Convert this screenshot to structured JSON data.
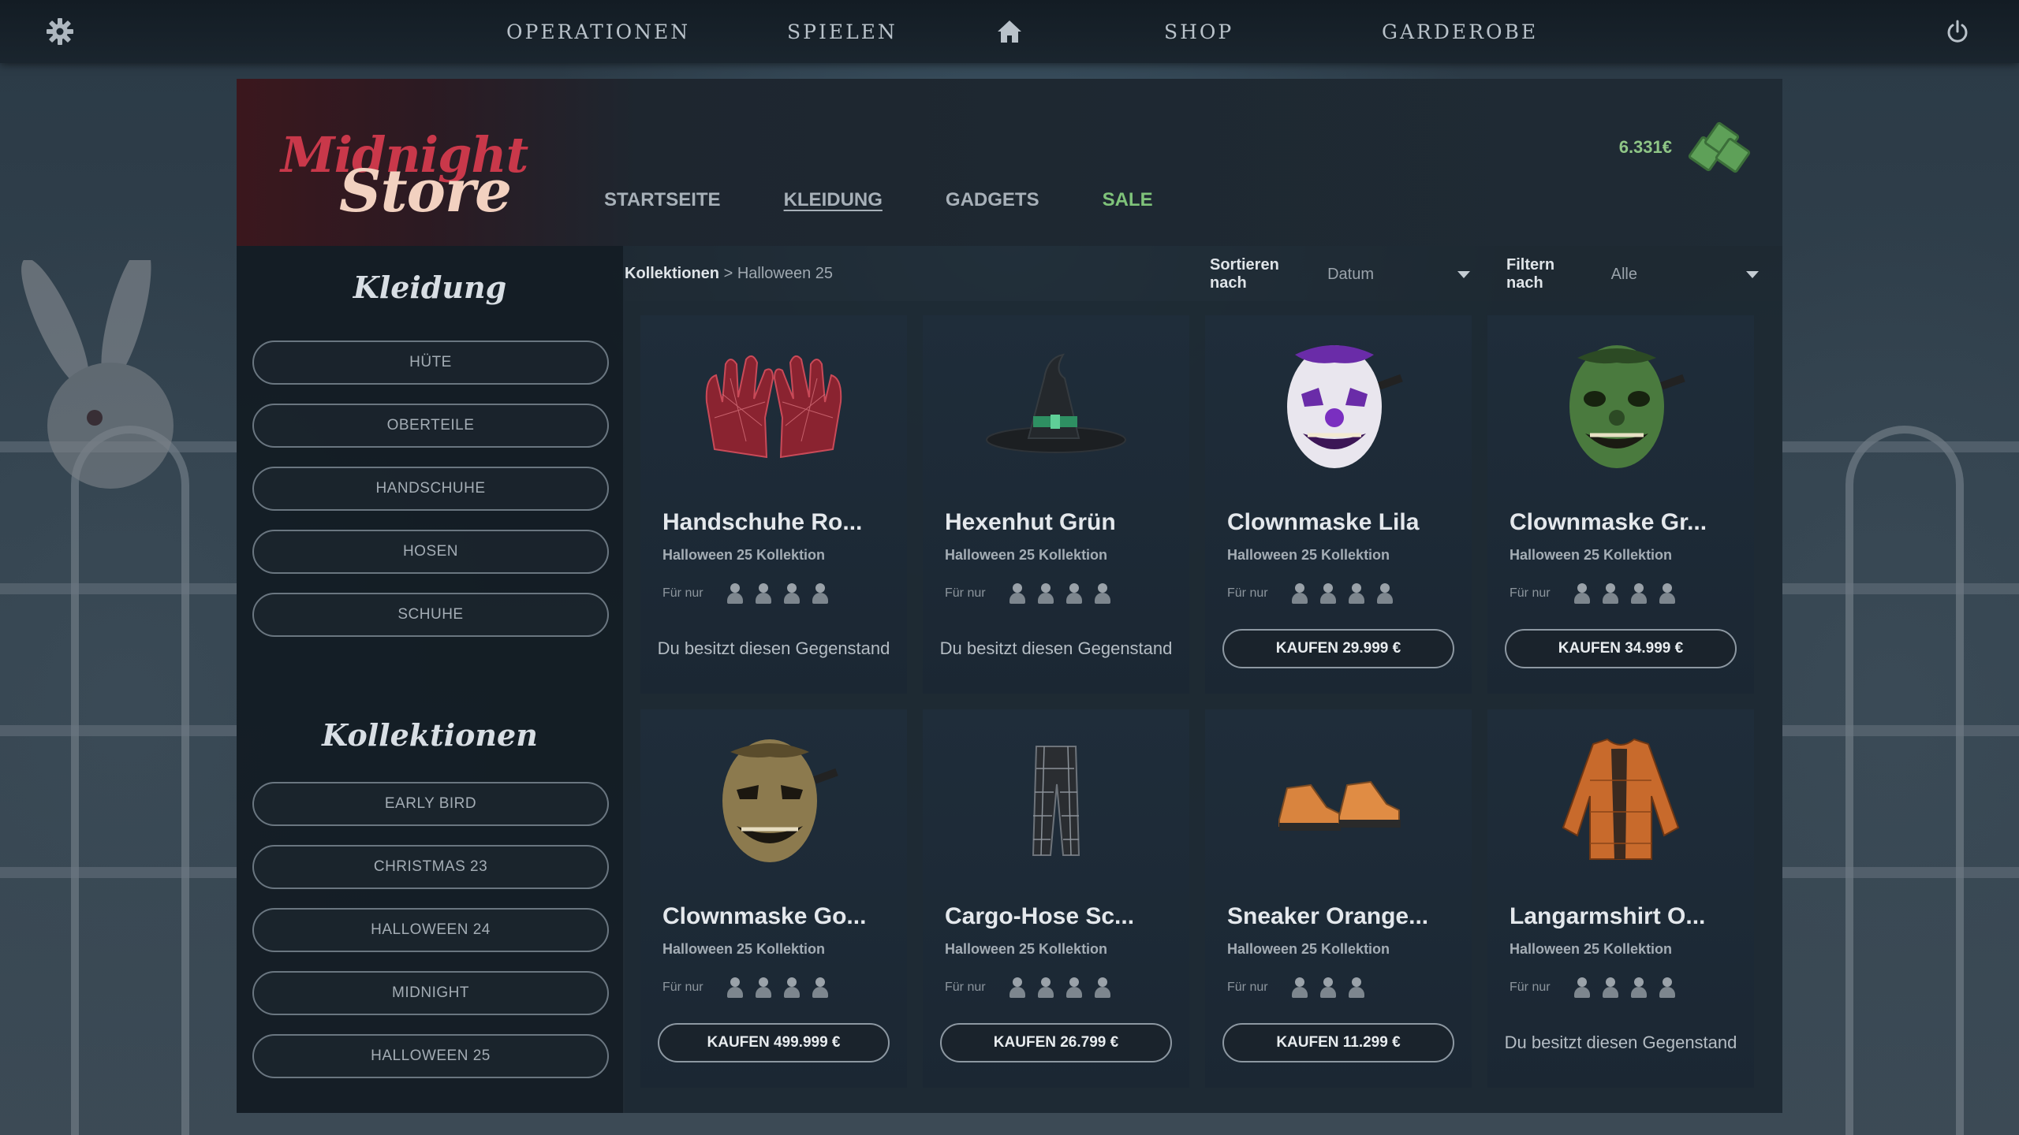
{
  "topnav": {
    "items": [
      "OPERATIONEN",
      "SPIELEN",
      "SHOP",
      "GARDEROBE"
    ]
  },
  "logo": {
    "line1": "Midnight",
    "line2": "Store"
  },
  "store_tabs": [
    "STARTSEITE",
    "KLEIDUNG",
    "GADGETS",
    "SALE"
  ],
  "balance": "6.331€",
  "sidebar": {
    "kleidung_title": "Kleidung",
    "kleidung_items": [
      "HÜTE",
      "OBERTEILE",
      "HANDSCHUHE",
      "HOSEN",
      "SCHUHE"
    ],
    "kollektionen_title": "Kollektionen",
    "kollektionen_items": [
      "EARLY BIRD",
      "CHRISTMAS 23",
      "HALLOWEEN 24",
      "MIDNIGHT",
      "HALLOWEEN 25"
    ]
  },
  "breadcrumb": {
    "root": "Kollektionen",
    "separator": ">",
    "current": "Halloween 25"
  },
  "sort": {
    "label": "Sortieren nach",
    "value": "Datum"
  },
  "filter": {
    "label": "Filtern nach",
    "value": "Alle"
  },
  "for_label": "Für nur",
  "owned_text": "Du besitzt diesen Gegenstand",
  "products": [
    {
      "name": "Handschuhe Ro...",
      "collection": "Halloween 25 Kollektion",
      "avatars": 4,
      "buy": null,
      "icon": "gloves-icon"
    },
    {
      "name": "Hexenhut Grün",
      "collection": "Halloween 25 Kollektion",
      "avatars": 4,
      "buy": null,
      "icon": "witch-hat-icon"
    },
    {
      "name": "Clownmaske Lila",
      "collection": "Halloween 25 Kollektion",
      "avatars": 4,
      "buy": "KAUFEN 29.999 €",
      "icon": "clown-mask-purple-icon"
    },
    {
      "name": "Clownmaske Gr...",
      "collection": "Halloween 25 Kollektion",
      "avatars": 4,
      "buy": "KAUFEN 34.999 €",
      "icon": "clown-mask-green-icon"
    },
    {
      "name": "Clownmaske Go...",
      "collection": "Halloween 25 Kollektion",
      "avatars": 4,
      "buy": "KAUFEN 499.999 €",
      "icon": "clown-mask-gold-icon"
    },
    {
      "name": "Cargo-Hose Sc...",
      "collection": "Halloween 25 Kollektion",
      "avatars": 4,
      "buy": "KAUFEN 26.799 €",
      "icon": "cargo-pants-icon"
    },
    {
      "name": "Sneaker Orange...",
      "collection": "Halloween 25 Kollektion",
      "avatars": 3,
      "buy": "KAUFEN 11.299 €",
      "icon": "sneakers-icon"
    },
    {
      "name": "Langarmshirt O...",
      "collection": "Halloween 25 Kollektion",
      "avatars": 4,
      "buy": null,
      "icon": "long-sleeve-shirt-icon"
    }
  ],
  "colors": {
    "accent_sale": "#7fc37a",
    "logo_red": "#c9384a",
    "balance_green": "#8fc686"
  }
}
